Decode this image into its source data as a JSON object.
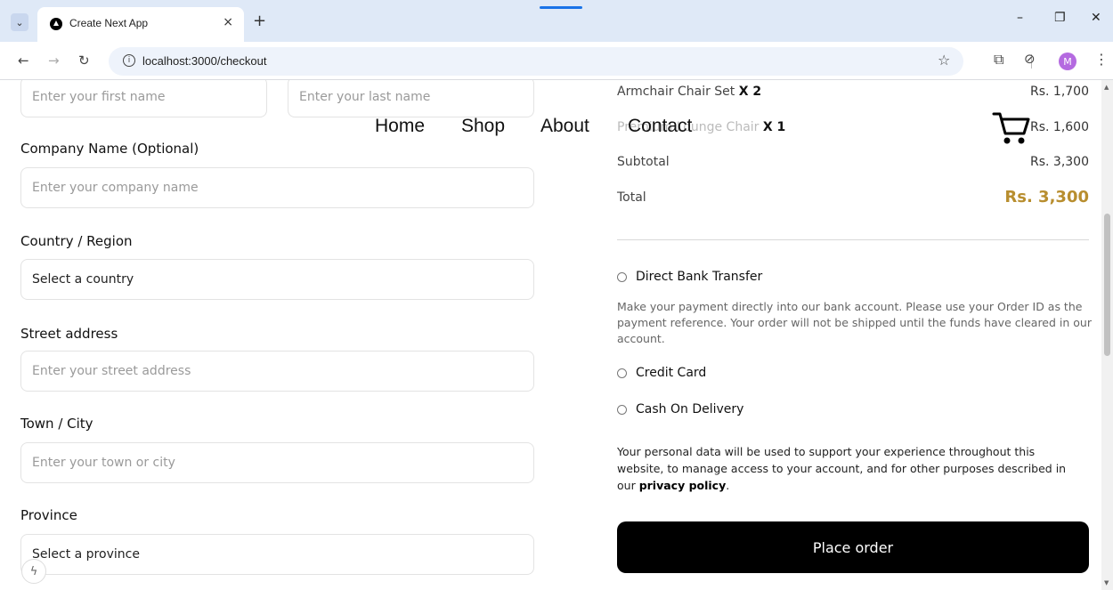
{
  "browser": {
    "tab_title": "Create Next App",
    "tab_close": "×",
    "new_tab": "+",
    "url": "localhost:3000/checkout",
    "avatar_letter": "M",
    "minimize": "–",
    "restore": "❐",
    "close": "✕"
  },
  "nav": {
    "items": [
      "Home",
      "Shop",
      "About",
      "Contact"
    ]
  },
  "form": {
    "first_name_placeholder": "Enter your first name",
    "last_name_placeholder": "Enter your last name",
    "company_label": "Company Name (Optional)",
    "company_placeholder": "Enter your company name",
    "country_label": "Country / Region",
    "country_value": "Select a country",
    "street_label": "Street address",
    "street_placeholder": "Enter your street address",
    "town_label": "Town / City",
    "town_placeholder": "Enter your town or city",
    "province_label": "Province",
    "province_value": "Select a province"
  },
  "summary": {
    "items": [
      {
        "name": "Armchair Chair Set",
        "qty": "X 2",
        "price": "Rs. 1,700"
      },
      {
        "name": "Premium Lounge Chair",
        "qty": "X 1",
        "price": "Rs. 1,600"
      }
    ],
    "subtotal_label": "Subtotal",
    "subtotal_value": "Rs. 3,300",
    "total_label": "Total",
    "total_value": "Rs. 3,300"
  },
  "payment": {
    "option1": "Direct Bank Transfer",
    "option1_desc": "Make your payment directly into our bank account. Please use your Order ID as the payment reference. Your order will not be shipped until the funds have cleared in our account.",
    "option2": "Credit Card",
    "option3": "Cash On Delivery",
    "privacy_prefix": "Your personal data will be used to support your experience throughout this website, to manage access to your account, and for other purposes described in our ",
    "privacy_link": "privacy policy",
    "privacy_suffix": ".",
    "place_order": "Place order"
  },
  "colors": {
    "accent_gold": "#b88e2f",
    "button_black": "#000000"
  }
}
